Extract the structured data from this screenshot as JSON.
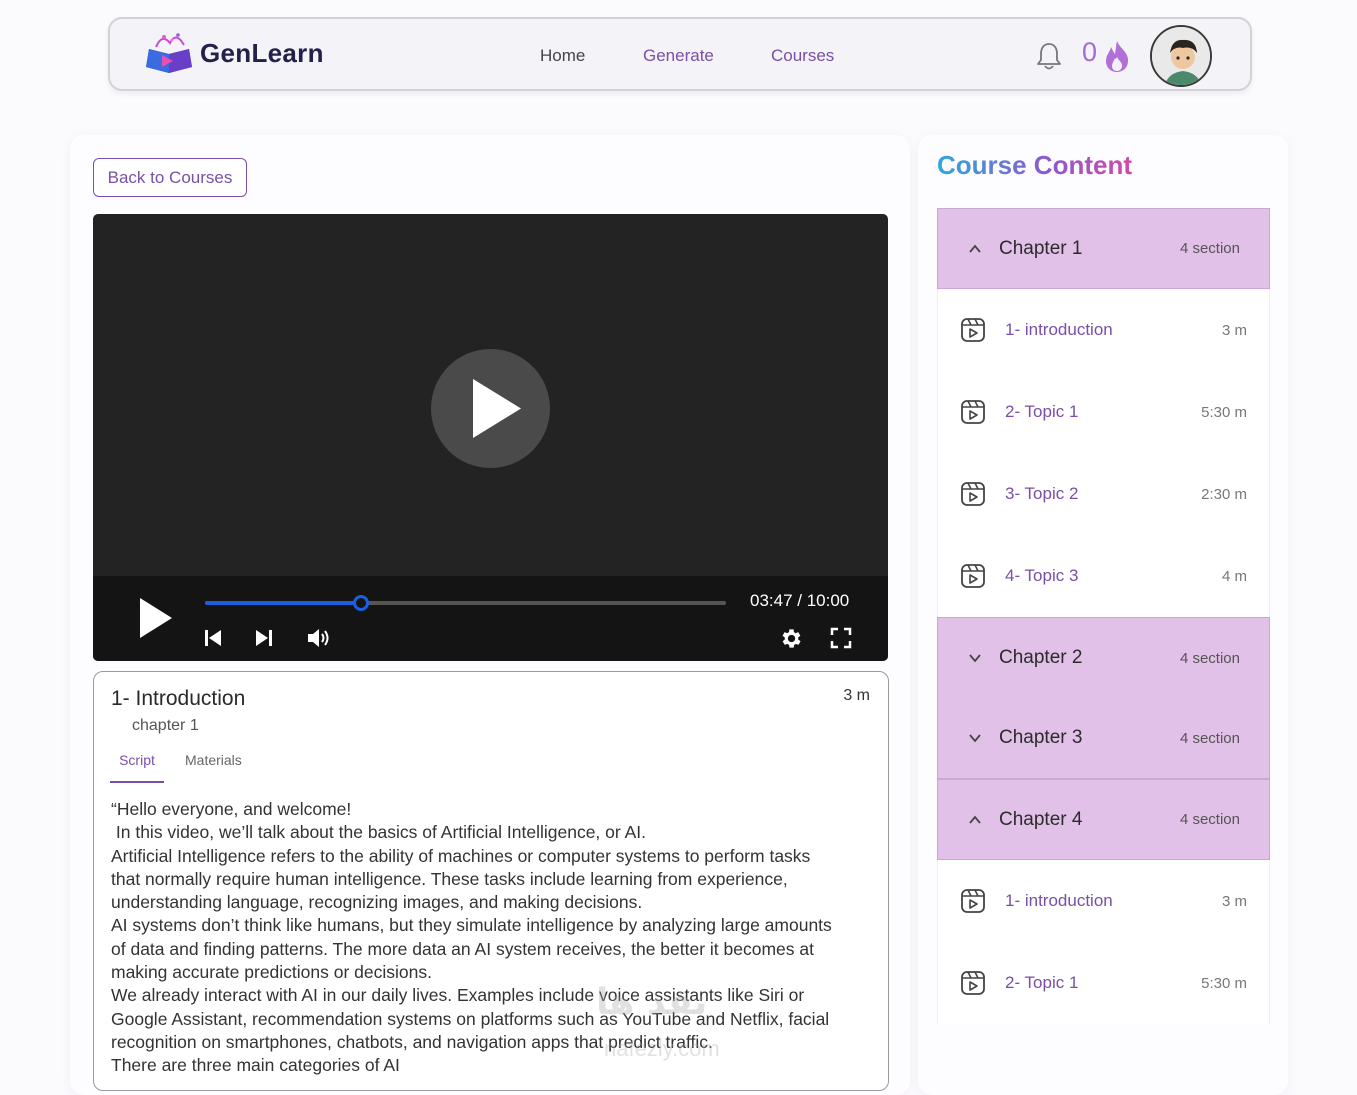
{
  "header": {
    "brand": "GenLearn",
    "nav": {
      "home": "Home",
      "generate": "Generate",
      "courses": "Courses"
    },
    "streak_count": "0",
    "icons": {
      "bell": "bell-icon",
      "flame": "flame-icon",
      "avatar": "user-avatar"
    }
  },
  "page": {
    "back_label": "Back to Courses"
  },
  "player": {
    "time": "03:47 / 10:00",
    "progress": 0.3
  },
  "lesson": {
    "title": "1- Introduction",
    "duration": "3 m",
    "chapter": "chapter 1",
    "tabs": {
      "script": "Script",
      "materials": "Materials"
    },
    "script": "“Hello everyone, and welcome!\n In this video, we’ll talk about the basics of Artificial Intelligence, or AI.\nArtificial Intelligence refers to the ability of machines or computer systems to perform tasks\nthat normally require human intelligence. These tasks include learning from experience,\nunderstanding language, recognizing images, and making decisions.\nAI systems don’t think like humans, but they simulate intelligence by analyzing large amounts\nof data and finding patterns. The more data an AI system receives, the better it becomes at\nmaking accurate predictions or decisions.\nWe already interact with AI in our daily lives. Examples include voice assistants like Siri or\nGoogle Assistant, recommendation systems on platforms such as YouTube and Netflix, facial\nrecognition on smartphones, chatbots, and navigation apps that predict traffic.\nThere are three main categories of AI"
  },
  "course_content": {
    "title": "Course Content",
    "chapters": [
      {
        "name": "Chapter 1",
        "count": "4 section",
        "expanded": true,
        "lessons": [
          {
            "name": "1- introduction",
            "time": "3 m"
          },
          {
            "name": "2- Topic 1",
            "time": "5:30 m"
          },
          {
            "name": "3- Topic 2",
            "time": "2:30 m"
          },
          {
            "name": "4- Topic 3",
            "time": "4 m"
          }
        ]
      },
      {
        "name": "Chapter 2",
        "count": "4 section",
        "expanded": false
      },
      {
        "name": "Chapter 3",
        "count": "4 section",
        "expanded": false
      },
      {
        "name": "Chapter 4",
        "count": "4 section",
        "expanded": true,
        "lessons": [
          {
            "name": "1- introduction",
            "time": "3 m"
          },
          {
            "name": "2- Topic 1",
            "time": "5:30 m"
          }
        ]
      }
    ]
  },
  "watermark": {
    "main": "نفذ ها",
    "sub": "nafezly.com"
  }
}
